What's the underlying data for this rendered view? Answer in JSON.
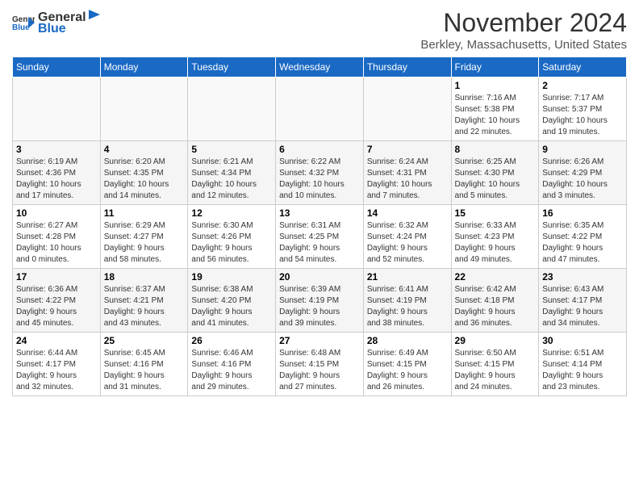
{
  "logo": {
    "general": "General",
    "blue": "Blue"
  },
  "title": "November 2024",
  "location": "Berkley, Massachusetts, United States",
  "days_of_week": [
    "Sunday",
    "Monday",
    "Tuesday",
    "Wednesday",
    "Thursday",
    "Friday",
    "Saturday"
  ],
  "weeks": [
    [
      {
        "day": "",
        "info": ""
      },
      {
        "day": "",
        "info": ""
      },
      {
        "day": "",
        "info": ""
      },
      {
        "day": "",
        "info": ""
      },
      {
        "day": "",
        "info": ""
      },
      {
        "day": "1",
        "info": "Sunrise: 7:16 AM\nSunset: 5:38 PM\nDaylight: 10 hours\nand 22 minutes."
      },
      {
        "day": "2",
        "info": "Sunrise: 7:17 AM\nSunset: 5:37 PM\nDaylight: 10 hours\nand 19 minutes."
      }
    ],
    [
      {
        "day": "3",
        "info": "Sunrise: 6:19 AM\nSunset: 4:36 PM\nDaylight: 10 hours\nand 17 minutes."
      },
      {
        "day": "4",
        "info": "Sunrise: 6:20 AM\nSunset: 4:35 PM\nDaylight: 10 hours\nand 14 minutes."
      },
      {
        "day": "5",
        "info": "Sunrise: 6:21 AM\nSunset: 4:34 PM\nDaylight: 10 hours\nand 12 minutes."
      },
      {
        "day": "6",
        "info": "Sunrise: 6:22 AM\nSunset: 4:32 PM\nDaylight: 10 hours\nand 10 minutes."
      },
      {
        "day": "7",
        "info": "Sunrise: 6:24 AM\nSunset: 4:31 PM\nDaylight: 10 hours\nand 7 minutes."
      },
      {
        "day": "8",
        "info": "Sunrise: 6:25 AM\nSunset: 4:30 PM\nDaylight: 10 hours\nand 5 minutes."
      },
      {
        "day": "9",
        "info": "Sunrise: 6:26 AM\nSunset: 4:29 PM\nDaylight: 10 hours\nand 3 minutes."
      }
    ],
    [
      {
        "day": "10",
        "info": "Sunrise: 6:27 AM\nSunset: 4:28 PM\nDaylight: 10 hours\nand 0 minutes."
      },
      {
        "day": "11",
        "info": "Sunrise: 6:29 AM\nSunset: 4:27 PM\nDaylight: 9 hours\nand 58 minutes."
      },
      {
        "day": "12",
        "info": "Sunrise: 6:30 AM\nSunset: 4:26 PM\nDaylight: 9 hours\nand 56 minutes."
      },
      {
        "day": "13",
        "info": "Sunrise: 6:31 AM\nSunset: 4:25 PM\nDaylight: 9 hours\nand 54 minutes."
      },
      {
        "day": "14",
        "info": "Sunrise: 6:32 AM\nSunset: 4:24 PM\nDaylight: 9 hours\nand 52 minutes."
      },
      {
        "day": "15",
        "info": "Sunrise: 6:33 AM\nSunset: 4:23 PM\nDaylight: 9 hours\nand 49 minutes."
      },
      {
        "day": "16",
        "info": "Sunrise: 6:35 AM\nSunset: 4:22 PM\nDaylight: 9 hours\nand 47 minutes."
      }
    ],
    [
      {
        "day": "17",
        "info": "Sunrise: 6:36 AM\nSunset: 4:22 PM\nDaylight: 9 hours\nand 45 minutes."
      },
      {
        "day": "18",
        "info": "Sunrise: 6:37 AM\nSunset: 4:21 PM\nDaylight: 9 hours\nand 43 minutes."
      },
      {
        "day": "19",
        "info": "Sunrise: 6:38 AM\nSunset: 4:20 PM\nDaylight: 9 hours\nand 41 minutes."
      },
      {
        "day": "20",
        "info": "Sunrise: 6:39 AM\nSunset: 4:19 PM\nDaylight: 9 hours\nand 39 minutes."
      },
      {
        "day": "21",
        "info": "Sunrise: 6:41 AM\nSunset: 4:19 PM\nDaylight: 9 hours\nand 38 minutes."
      },
      {
        "day": "22",
        "info": "Sunrise: 6:42 AM\nSunset: 4:18 PM\nDaylight: 9 hours\nand 36 minutes."
      },
      {
        "day": "23",
        "info": "Sunrise: 6:43 AM\nSunset: 4:17 PM\nDaylight: 9 hours\nand 34 minutes."
      }
    ],
    [
      {
        "day": "24",
        "info": "Sunrise: 6:44 AM\nSunset: 4:17 PM\nDaylight: 9 hours\nand 32 minutes."
      },
      {
        "day": "25",
        "info": "Sunrise: 6:45 AM\nSunset: 4:16 PM\nDaylight: 9 hours\nand 31 minutes."
      },
      {
        "day": "26",
        "info": "Sunrise: 6:46 AM\nSunset: 4:16 PM\nDaylight: 9 hours\nand 29 minutes."
      },
      {
        "day": "27",
        "info": "Sunrise: 6:48 AM\nSunset: 4:15 PM\nDaylight: 9 hours\nand 27 minutes."
      },
      {
        "day": "28",
        "info": "Sunrise: 6:49 AM\nSunset: 4:15 PM\nDaylight: 9 hours\nand 26 minutes."
      },
      {
        "day": "29",
        "info": "Sunrise: 6:50 AM\nSunset: 4:15 PM\nDaylight: 9 hours\nand 24 minutes."
      },
      {
        "day": "30",
        "info": "Sunrise: 6:51 AM\nSunset: 4:14 PM\nDaylight: 9 hours\nand 23 minutes."
      }
    ]
  ]
}
